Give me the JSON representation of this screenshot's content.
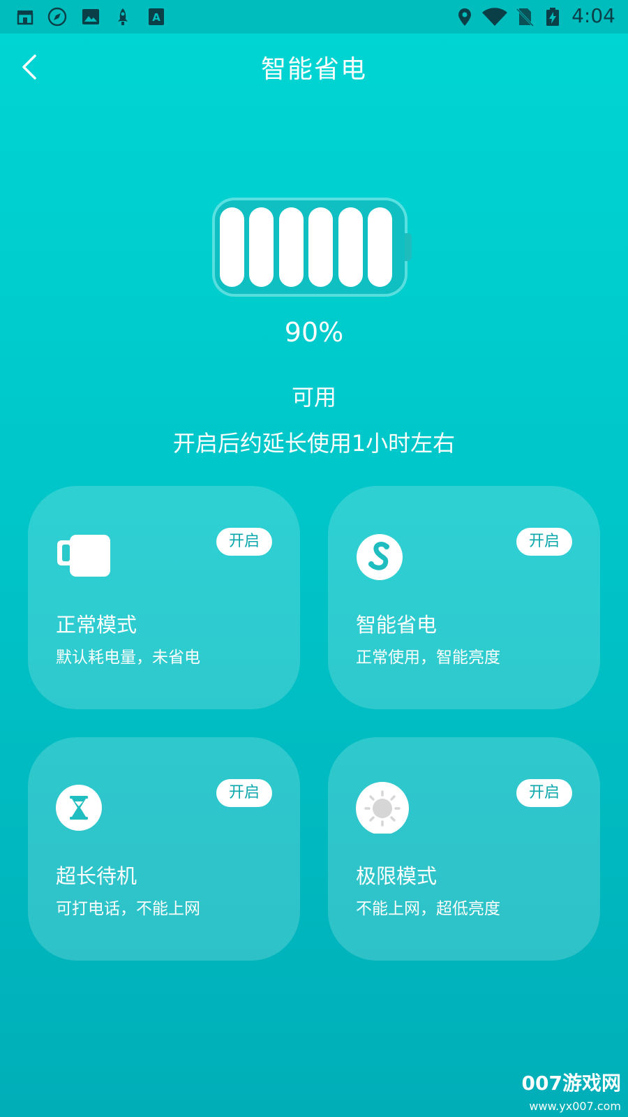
{
  "status_bar": {
    "time": "4:04",
    "left_icons": [
      "store-icon",
      "compass-icon",
      "image-icon",
      "rocket-icon",
      "text-a-icon"
    ],
    "right_icons": [
      "location-icon",
      "wifi-icon",
      "no-sim-icon",
      "battery-charging-icon"
    ]
  },
  "header": {
    "title": "智能省电",
    "back_icon": "chevron-left-icon"
  },
  "battery": {
    "percent_text": "90%",
    "level": 0.9,
    "status": "可用",
    "note": "开启后约延长使用1小时左右"
  },
  "modes": [
    {
      "title": "正常模式",
      "desc": "默认耗电量，未省电",
      "button": "开启",
      "icon": "battery-card-icon"
    },
    {
      "title": "智能省电",
      "desc": "正常使用，智能亮度",
      "button": "开启",
      "icon": "s-swirl-icon"
    },
    {
      "title": "超长待机",
      "desc": "可打电话，不能上网",
      "button": "开启",
      "icon": "hourglass-icon"
    },
    {
      "title": "极限模式",
      "desc": "不能上网，超低亮度",
      "button": "开启",
      "icon": "sun-icon"
    }
  ],
  "watermark": {
    "brand": "007游戏网",
    "url": "www.yx007.com"
  },
  "colors": {
    "accent": "#0aa7ad",
    "status_bar_bg": "#00bdbd",
    "bg_top": "#00d6d4",
    "bg_bottom": "#00aeb8"
  }
}
